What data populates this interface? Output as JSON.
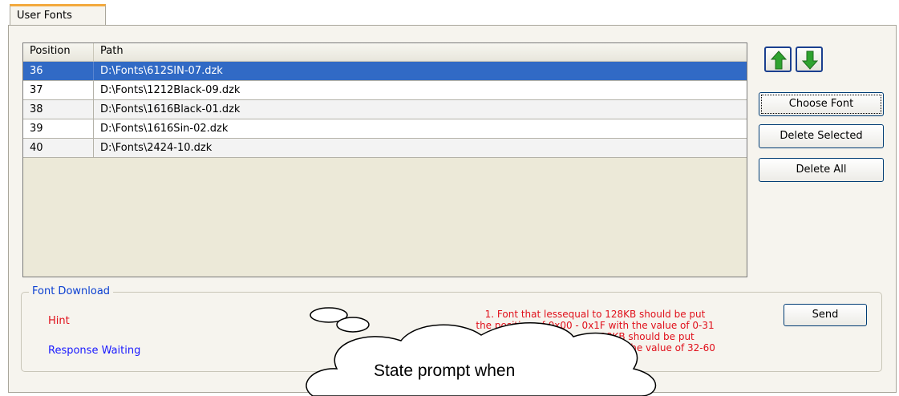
{
  "tab": {
    "label": "User Fonts"
  },
  "list": {
    "headers": {
      "position": "Position",
      "path": "Path"
    },
    "rows": [
      {
        "position": "36",
        "path": "D:\\Fonts\\612SIN-07.dzk"
      },
      {
        "position": "37",
        "path": "D:\\Fonts\\1212Black-09.dzk"
      },
      {
        "position": "38",
        "path": "D:\\Fonts\\1616Black-01.dzk"
      },
      {
        "position": "39",
        "path": "D:\\Fonts\\1616Sin-02.dzk"
      },
      {
        "position": "40",
        "path": "D:\\Fonts\\2424-10.dzk"
      }
    ],
    "selected_index": 0
  },
  "buttons": {
    "move_up_icon": "green-up-arrow-icon",
    "move_down_icon": "green-down-arrow-icon",
    "choose_font": "Choose Font",
    "delete_selected": "Delete Selected",
    "delete_all": "Delete All",
    "send": "Send"
  },
  "font_download": {
    "title": "Font Download",
    "hint": "Hint",
    "response": "Response Waiting",
    "notes": [
      "1. Font that lessequal to 128KB should be put",
      "the position of 0x00 - 0x1F with the value of 0-31",
      "28KB should be put",
      "ith the value of 32-60"
    ]
  },
  "callout": {
    "text": "State prompt when"
  },
  "colors": {
    "selection": "#316ac5",
    "hint": "#e0101b",
    "response": "#1a1aff",
    "tab_accent": "#f3a93d"
  }
}
